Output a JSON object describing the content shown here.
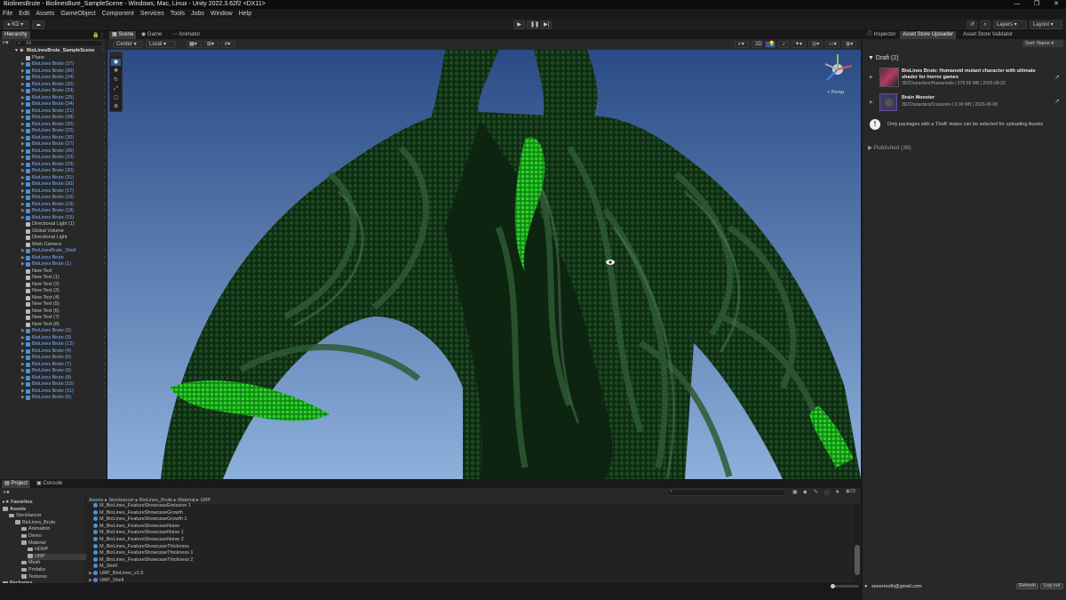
{
  "window": {
    "title": "BiolinesBrute - BiolinesBure_SampleScene - Windows, Mac, Linux - Unity 2022.3.62f2 <DX11>"
  },
  "menu": [
    "File",
    "Edit",
    "Assets",
    "GameObject",
    "Component",
    "Services",
    "Tools",
    "Jobs",
    "Window",
    "Help"
  ],
  "toolbar": {
    "account": "KD",
    "layers": "Layers",
    "layout": "Layout"
  },
  "hierarchy": {
    "tab": "Hierarchy",
    "search_placeholder": "All",
    "scene": "BioLinesBrute_SampleScene",
    "items": [
      {
        "label": "Plane",
        "kind": "white"
      },
      {
        "label": "BioLines Brute (37)",
        "kind": "blue"
      },
      {
        "label": "BioLines Brute (36)",
        "kind": "blue"
      },
      {
        "label": "BioLines Brute (24)",
        "kind": "blue"
      },
      {
        "label": "BioLines Brute (32)",
        "kind": "blue"
      },
      {
        "label": "BioLines Brute (33)",
        "kind": "blue"
      },
      {
        "label": "BioLines Brute (25)",
        "kind": "blue"
      },
      {
        "label": "BioLines Brute (34)",
        "kind": "blue"
      },
      {
        "label": "BioLines Brute (21)",
        "kind": "blue"
      },
      {
        "label": "BioLines Brute (28)",
        "kind": "blue"
      },
      {
        "label": "BioLines Brute (35)",
        "kind": "blue"
      },
      {
        "label": "BioLines Brute (22)",
        "kind": "blue"
      },
      {
        "label": "BioLines Brute (30)",
        "kind": "blue"
      },
      {
        "label": "BioLines Brute (27)",
        "kind": "blue"
      },
      {
        "label": "BioLines Brute (26)",
        "kind": "blue"
      },
      {
        "label": "BioLines Brute (23)",
        "kind": "blue"
      },
      {
        "label": "BioLines Brute (29)",
        "kind": "blue"
      },
      {
        "label": "BioLines Brute (20)",
        "kind": "blue"
      },
      {
        "label": "BioLines Brute (31)",
        "kind": "blue"
      },
      {
        "label": "BioLines Brute (30)",
        "kind": "blue"
      },
      {
        "label": "BioLines Brute (17)",
        "kind": "blue"
      },
      {
        "label": "BioLines Brute (16)",
        "kind": "blue"
      },
      {
        "label": "BioLines Brute (19)",
        "kind": "blue"
      },
      {
        "label": "BioLines Brute (18)",
        "kind": "blue"
      },
      {
        "label": "BioLines Brute (15)",
        "kind": "blue"
      },
      {
        "label": "Directional Light (1)",
        "kind": "white"
      },
      {
        "label": "Global Volume",
        "kind": "white"
      },
      {
        "label": "Directional Light",
        "kind": "white"
      },
      {
        "label": "Main Camera",
        "kind": "white"
      },
      {
        "label": "BioLinesBrute_Shell",
        "kind": "blue"
      },
      {
        "label": "BioLines Brute",
        "kind": "blue"
      },
      {
        "label": "BioLines Brute (1)",
        "kind": "blue"
      },
      {
        "label": "New Text",
        "kind": "white"
      },
      {
        "label": "New Text (1)",
        "kind": "white"
      },
      {
        "label": "New Text (2)",
        "kind": "white"
      },
      {
        "label": "New Text (3)",
        "kind": "white"
      },
      {
        "label": "New Text (4)",
        "kind": "white"
      },
      {
        "label": "New Text (5)",
        "kind": "white"
      },
      {
        "label": "New Text (6)",
        "kind": "white"
      },
      {
        "label": "New Text (7)",
        "kind": "white"
      },
      {
        "label": "New Text (8)",
        "kind": "white"
      },
      {
        "label": "BioLines Brute (2)",
        "kind": "blue"
      },
      {
        "label": "BioLines Brute (3)",
        "kind": "blue"
      },
      {
        "label": "BioLines Brute (12)",
        "kind": "blue"
      },
      {
        "label": "BioLines Brute (4)",
        "kind": "blue"
      },
      {
        "label": "BioLines Brute (5)",
        "kind": "blue"
      },
      {
        "label": "BioLines Brute (7)",
        "kind": "blue"
      },
      {
        "label": "BioLines Brute (9)",
        "kind": "blue"
      },
      {
        "label": "BioLines Brute (8)",
        "kind": "blue"
      },
      {
        "label": "BioLines Brute (10)",
        "kind": "blue"
      },
      {
        "label": "BioLines Brute (11)",
        "kind": "blue"
      },
      {
        "label": "BioLines Brute (6)",
        "kind": "blue"
      }
    ]
  },
  "scene": {
    "tabs": [
      "Scene",
      "Game",
      "Animator"
    ],
    "pivot": "Center",
    "space": "Local",
    "mode_2d": "2D",
    "persp": "< Persp"
  },
  "inspector": {
    "tabs": [
      "Inspector",
      "Asset Store Uploader",
      "Asset Store Validator"
    ],
    "sort": "Sort: Name",
    "draft_header": "Draft (2)",
    "packages": [
      {
        "title": "BioLines Brute: Humanoid mutant character with ultimate shader for horror games",
        "meta": "3D/Characters/Humanoids | 578.55 MB | 2026-08-22"
      },
      {
        "title": "Brain Monster",
        "meta": "3D/Characters/Creatures | 6.00 MB | 2026-08-08"
      }
    ],
    "info_text": "Only packages with a 'Draft' status can be selected for uploading Assets",
    "published_header": "Published (38)"
  },
  "project": {
    "tabs": [
      "Project",
      "Console"
    ],
    "breadcrumb": [
      "Assets",
      "Stocklancer",
      "BioLines_Brute",
      "Material",
      "URP"
    ],
    "tree": [
      {
        "label": "Favorites",
        "level": 0,
        "star": true
      },
      {
        "label": "Assets",
        "level": 0
      },
      {
        "label": "Stocklancer",
        "level": 1
      },
      {
        "label": "BioLines_Brute",
        "level": 2
      },
      {
        "label": "Animation",
        "level": 3
      },
      {
        "label": "Demo",
        "level": 3
      },
      {
        "label": "Material",
        "level": 3
      },
      {
        "label": "HDRP",
        "level": 4
      },
      {
        "label": "URP",
        "level": 4
      },
      {
        "label": "Mesh",
        "level": 3
      },
      {
        "label": "Prefabs",
        "level": 3
      },
      {
        "label": "Textures",
        "level": 3
      },
      {
        "label": "Packages",
        "level": 0
      }
    ],
    "files": [
      "M_BioLines_FeatureShowcaseEmission 1",
      "M_BioLines_FeatureShowcaseGrowth",
      "M_BioLines_FeatureShowcaseGrowth 1",
      "M_BioLines_FeatureShowcaseNoise",
      "M_BioLines_FeatureShowcaseNoise 1",
      "M_BioLines_FeatureShowcaseNoise 2",
      "M_BioLines_FeatureShowcaseThickness",
      "M_BioLines_FeatureShowcaseThickness 1",
      "M_BioLines_FeatureShowcaseThickness 2",
      "M_Shell",
      "URP_BioLines_v1.5",
      "URP_Shell"
    ],
    "count": "23"
  },
  "status": {
    "email": "severrooth@gmail.com",
    "refresh": "Refresh",
    "logout": "Log out"
  },
  "colors": {
    "accent": "#4a90d9",
    "hier_blue": "#7eb4ff",
    "sky_top": "#2d4f8a",
    "sky_bottom": "#7da3d6",
    "green": "#1fbf1f"
  }
}
